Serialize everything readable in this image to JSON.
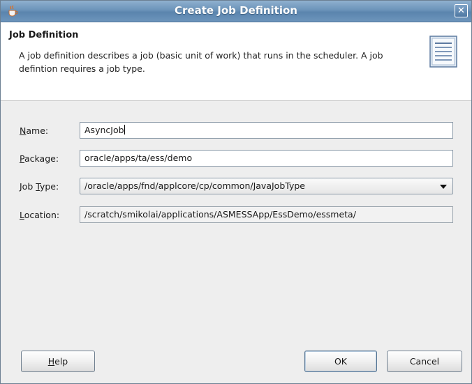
{
  "window": {
    "title": "Create Job Definition",
    "app_icon": "coffee-cup-icon",
    "close_icon": "close-icon",
    "close_glyph": "✕"
  },
  "header": {
    "title": "Job Definition",
    "description": "A job definition describes a job (basic unit of work) that runs in the scheduler.  A job defintion requires a job type.",
    "icon": "document-icon"
  },
  "form": {
    "name": {
      "label_mnemonic": "N",
      "label_rest": "ame:",
      "value": "AsyncJob"
    },
    "package": {
      "label_mnemonic": "P",
      "label_rest": "ackage:",
      "value": "oracle/apps/ta/ess/demo"
    },
    "job_type": {
      "label_pre": "Job ",
      "label_mnemonic": "T",
      "label_rest": "ype:",
      "value": "/oracle/apps/fnd/applcore/cp/common/JavaJobType"
    },
    "location": {
      "label_mnemonic": "L",
      "label_rest": "ocation:",
      "value": "/scratch/smikolai/applications/ASMESSApp/EssDemo/essmeta/"
    }
  },
  "buttons": {
    "help_mnemonic": "H",
    "help_rest": "elp",
    "ok": "OK",
    "cancel": "Cancel"
  },
  "colors": {
    "titlebar": "#6b93b9",
    "dialog_bg": "#eeeeee",
    "header_bg": "#ffffff"
  }
}
